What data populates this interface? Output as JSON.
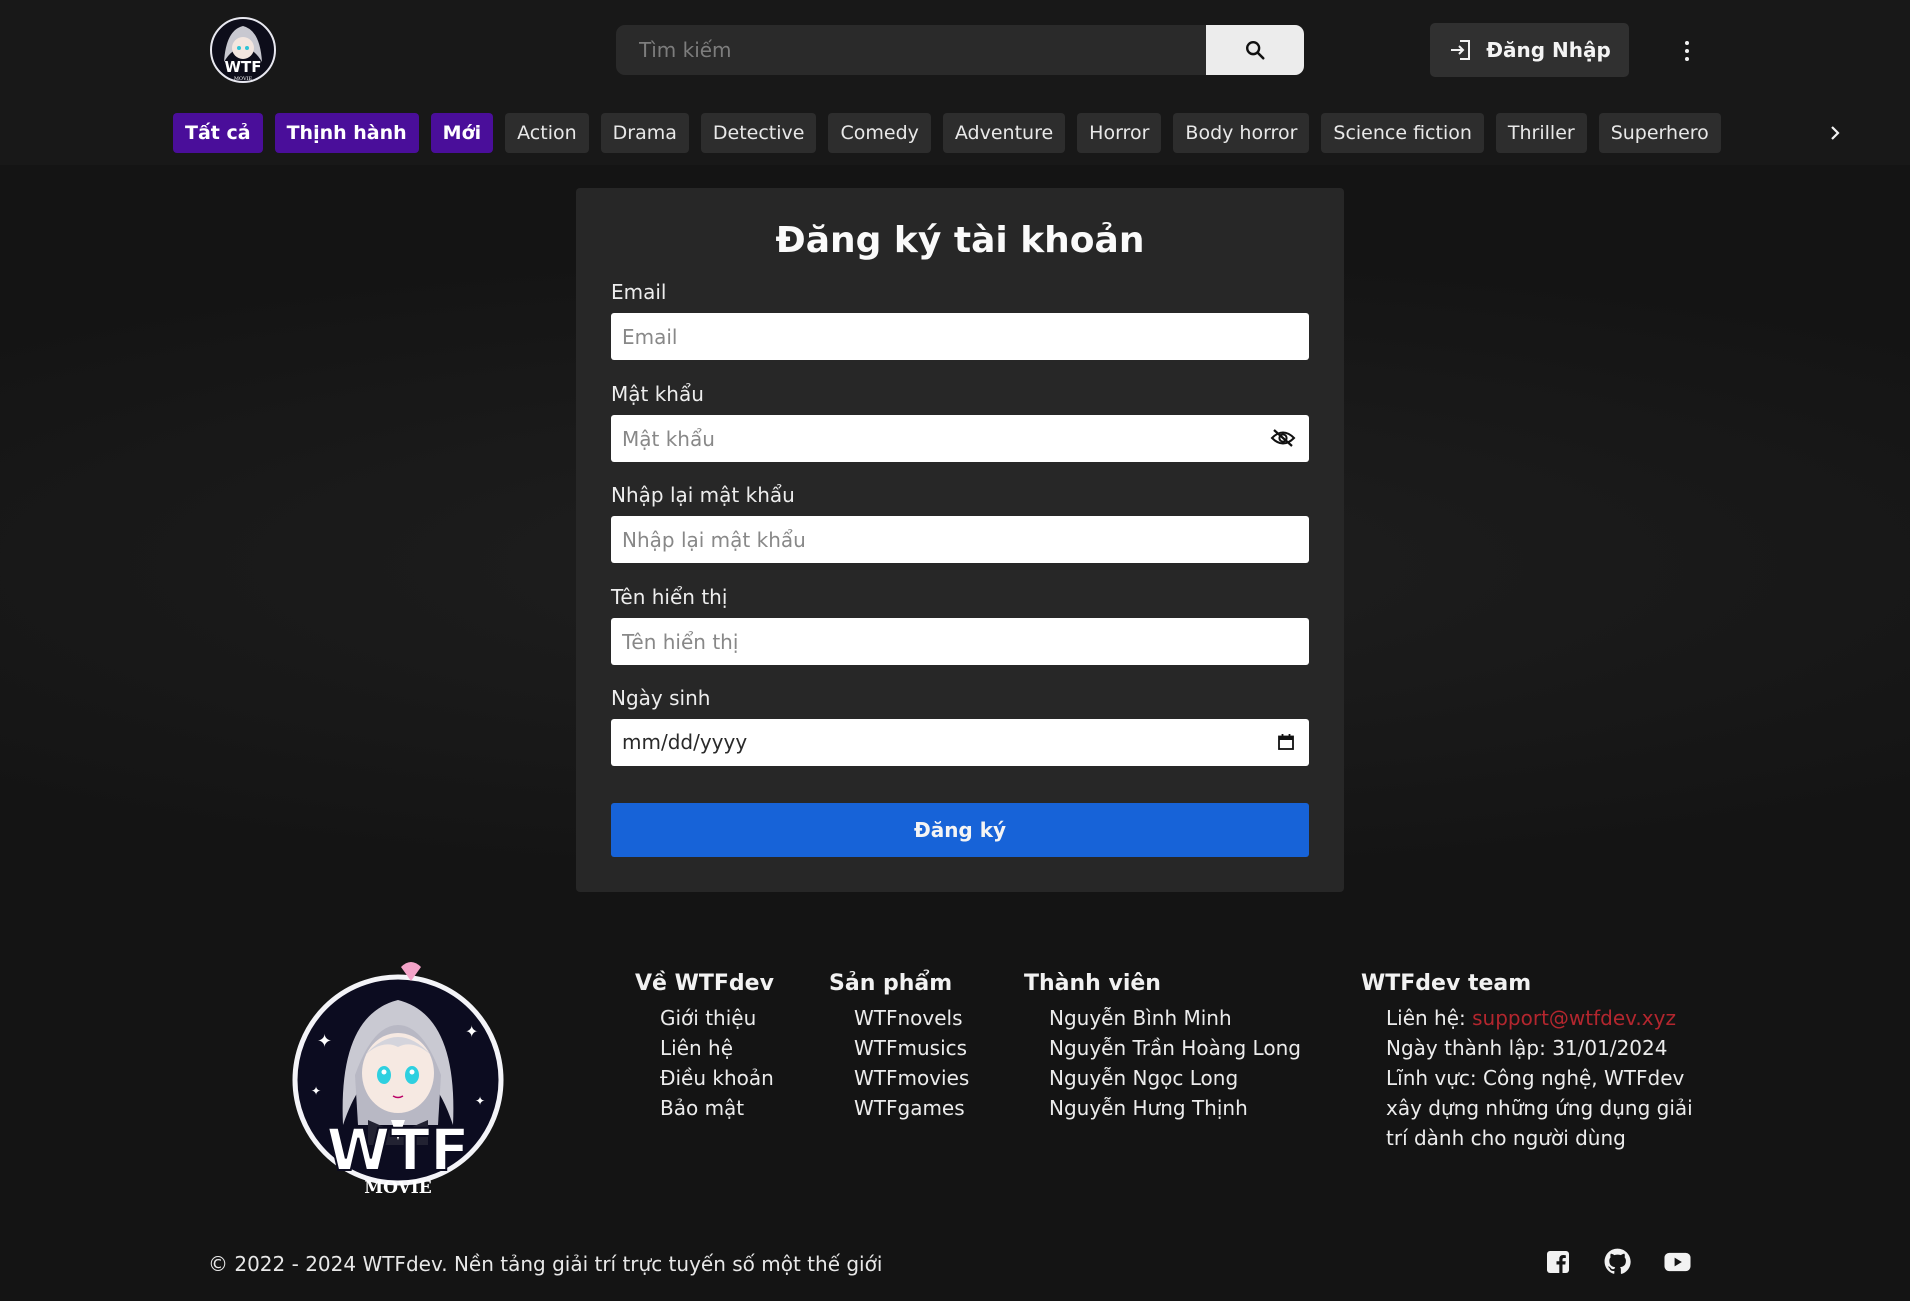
{
  "header": {
    "logo_text": "WTF",
    "logo_subtext": "MOVIE",
    "search_placeholder": "Tìm kiếm",
    "login_label": "Đăng Nhập"
  },
  "genres": [
    {
      "label": "Tất cả",
      "highlight": true
    },
    {
      "label": "Thịnh hành",
      "highlight": true
    },
    {
      "label": "Mới",
      "highlight": true
    },
    {
      "label": "Action",
      "highlight": false
    },
    {
      "label": "Drama",
      "highlight": false
    },
    {
      "label": "Detective",
      "highlight": false
    },
    {
      "label": "Comedy",
      "highlight": false
    },
    {
      "label": "Adventure",
      "highlight": false
    },
    {
      "label": "Horror",
      "highlight": false
    },
    {
      "label": "Body horror",
      "highlight": false
    },
    {
      "label": "Science fiction",
      "highlight": false
    },
    {
      "label": "Thriller",
      "highlight": false
    },
    {
      "label": "Superhero",
      "highlight": false
    }
  ],
  "form": {
    "title": "Đăng ký tài khoản",
    "email_label": "Email",
    "email_placeholder": "Email",
    "password_label": "Mật khẩu",
    "password_placeholder": "Mật khẩu",
    "confirm_label": "Nhập lại mật khẩu",
    "confirm_placeholder": "Nhập lại mật khẩu",
    "display_name_label": "Tên hiển thị",
    "display_name_placeholder": "Tên hiển thị",
    "birthday_label": "Ngày sinh",
    "birthday_placeholder": "mm/dd/yyyy",
    "submit_label": "Đăng ký"
  },
  "footer": {
    "logo_text": "WTF",
    "logo_subtext": "MOVIE",
    "about": {
      "title": "Về WTFdev",
      "items": [
        "Giới thiệu",
        "Liên hệ",
        "Điều khoản",
        "Bảo mật"
      ]
    },
    "products": {
      "title": "Sản phẩm",
      "items": [
        "WTFnovels",
        "WTFmusics",
        "WTFmovies",
        "WTFgames"
      ]
    },
    "members": {
      "title": "Thành viên",
      "items": [
        "Nguyễn Bình Minh",
        "Nguyễn Trần Hoàng Long",
        "Nguyễn Ngọc Long",
        "Nguyễn Hưng Thịnh"
      ]
    },
    "team": {
      "title": "WTFdev team",
      "contact_label": "Liên hệ: ",
      "contact_email": "support@wtfdev.xyz",
      "founded": "Ngày thành lập: 31/01/2024",
      "field_line1": "Lĩnh vực: Công nghệ, WTFdev",
      "field_line2": "xây dựng những ứng dụng giải",
      "field_line3": "trí dành cho người dùng"
    },
    "copyright": "© 2022 - 2024 WTFdev. Nền tảng giải trí trực tuyến số một thế giới"
  },
  "colors": {
    "accent_purple": "#4a0e9a",
    "submit_blue": "#1763d8",
    "contact_red": "#b3262e"
  },
  "icons": {
    "search": "search-icon",
    "login": "login-icon",
    "more": "more-vertical-icon",
    "next": "chevron-right-icon",
    "password_toggle": "eye-off-icon",
    "calendar": "calendar-icon",
    "facebook": "facebook-icon",
    "github": "github-icon",
    "youtube": "youtube-icon"
  }
}
